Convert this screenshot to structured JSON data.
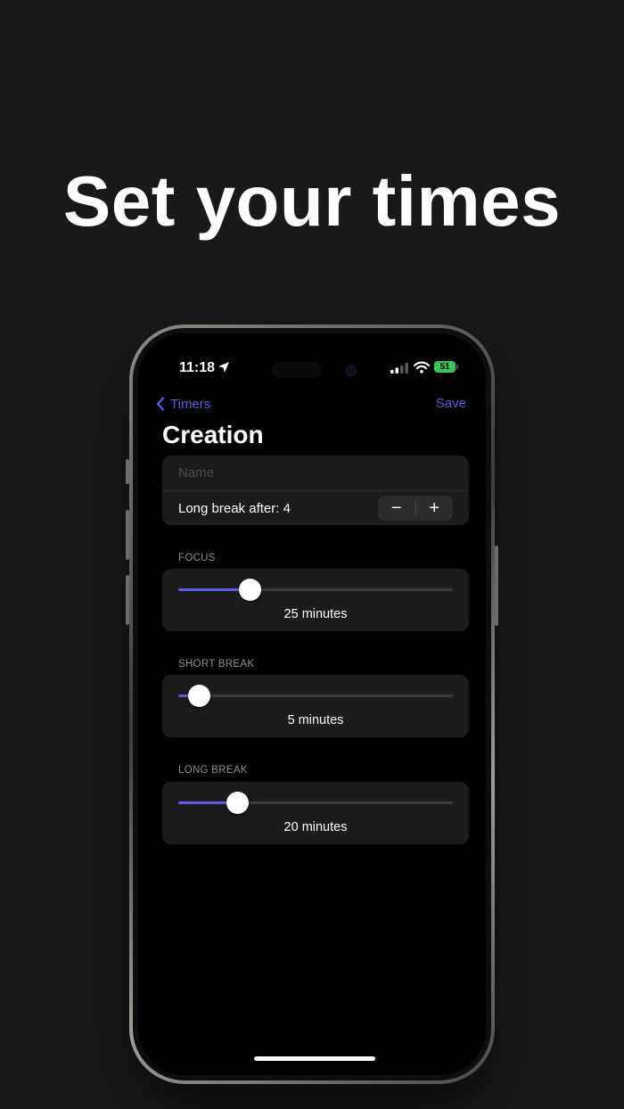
{
  "headline": "Set your times",
  "status": {
    "time": "11:18",
    "battery": "51"
  },
  "nav": {
    "back_label": "Timers",
    "save_label": "Save"
  },
  "page_title": "Creation",
  "form": {
    "name_placeholder": "Name",
    "name_value": "",
    "long_break_after_label": "Long break after: 4",
    "long_break_after_value": 4,
    "minus_symbol": "−",
    "plus_symbol": "+"
  },
  "sliders": {
    "focus": {
      "header": "FOCUS",
      "value_text": "25 minutes",
      "minutes": 25,
      "fraction": 0.26
    },
    "short_break": {
      "header": "SHORT BREAK",
      "value_text": "5 minutes",
      "minutes": 5,
      "fraction": 0.075
    },
    "long_break": {
      "header": "LONG BREAK",
      "value_text": "20 minutes",
      "minutes": 20,
      "fraction": 0.215
    }
  },
  "colors": {
    "accent": "#5e5ce6",
    "background": "#18191b",
    "screen": "#000000",
    "card": "#1c1c1e",
    "battery": "#34c759"
  }
}
